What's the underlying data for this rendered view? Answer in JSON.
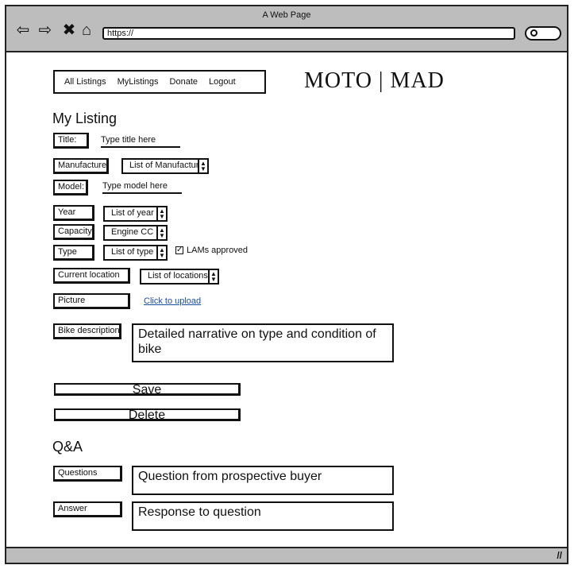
{
  "window": {
    "title": "A Web Page"
  },
  "browser": {
    "url": "https://"
  },
  "nav": {
    "items": [
      "All Listings",
      "MyListings",
      "Donate",
      "Logout"
    ]
  },
  "logo": {
    "text": "MOTO | MAD"
  },
  "listing": {
    "heading": "My Listing",
    "title_label": "Title:",
    "title_placeholder": "Type title here",
    "manufacture_label": "Manufacture",
    "manufacture_select": "List of Manufactur",
    "model_label": "Model:",
    "model_placeholder": "Type model here",
    "year_label": "Year",
    "year_select": "List of year",
    "capacity_label": "Capacity",
    "capacity_select": "Engine CC",
    "type_label": "Type",
    "type_select": "List of type",
    "lams_label": "LAMs approved",
    "lams_checked": true,
    "location_label": "Current location",
    "location_select": "List of locations",
    "picture_label": "Picture",
    "upload_link": "Click to upload",
    "description_label": "Bike description",
    "description_value": "Detailed narrative on type and condition of bike",
    "save_label": "Save",
    "delete_label": "Delete"
  },
  "qa": {
    "heading": "Q&A",
    "questions_label": "Questions",
    "question_value": "Question from prospective buyer",
    "answer_label": "Answer",
    "answer_value": "Response to question"
  },
  "icons": {
    "back": "back-arrow-icon",
    "forward": "forward-arrow-icon",
    "close": "close-icon",
    "home": "home-icon",
    "search": "search-icon",
    "resize": "resize-grip-icon"
  }
}
